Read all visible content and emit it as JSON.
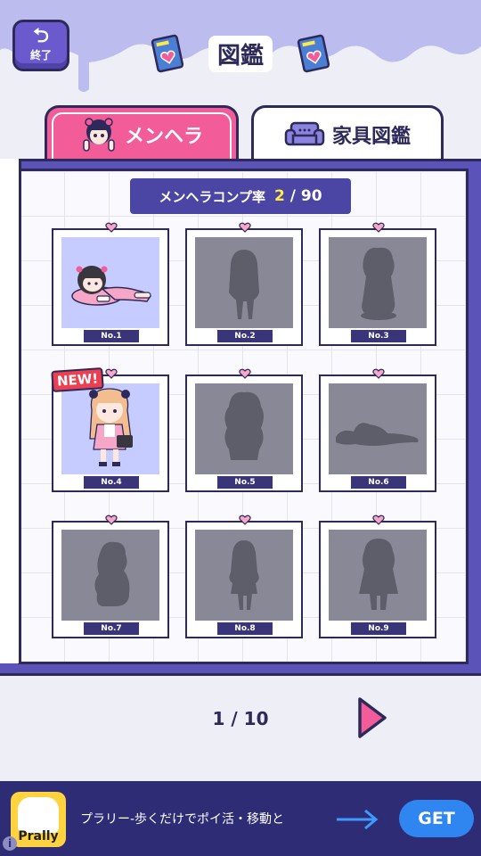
{
  "header": {
    "exit_icon": "return-icon",
    "exit_label": "終了",
    "title": "図鑑"
  },
  "tabs": [
    {
      "label": "メンヘラ",
      "icon": "menhera-girl-icon",
      "active": true
    },
    {
      "label": "家具図鑑",
      "icon": "sofa-icon",
      "active": false
    }
  ],
  "completion": {
    "label": "メンヘラコンプ率",
    "collected": "2",
    "total": "/ 90"
  },
  "cards": [
    {
      "no": "No.1",
      "unlocked": true
    },
    {
      "no": "No.2",
      "unlocked": false
    },
    {
      "no": "No.3",
      "unlocked": false
    },
    {
      "no": "No.4",
      "unlocked": true,
      "badge": "NEW!"
    },
    {
      "no": "No.5",
      "unlocked": false
    },
    {
      "no": "No.6",
      "unlocked": false
    },
    {
      "no": "No.7",
      "unlocked": false
    },
    {
      "no": "No.8",
      "unlocked": false
    },
    {
      "no": "No.9",
      "unlocked": false
    }
  ],
  "pager": {
    "text": "1 / 10",
    "next_icon": "next-page-arrow-icon"
  },
  "ad": {
    "logo_text": "Prally",
    "text": "プラリー-歩くだけでポイ活・移動と",
    "button": "GET",
    "info_icon": "i"
  },
  "colors": {
    "accent_pink": "#f25c98",
    "panel_purple": "#5b53b8",
    "outline": "#2d2a5a",
    "ad_bg": "#2d2c75",
    "get_blue": "#2f86f0"
  }
}
